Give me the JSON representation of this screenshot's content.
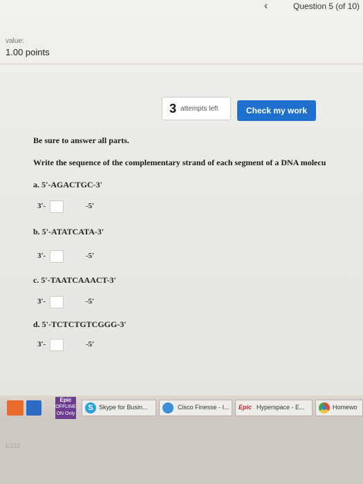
{
  "header": {
    "back_icon": "‹",
    "question": "Question 5 (of 10)"
  },
  "score": {
    "value_label": "value:",
    "points": "1.00 points"
  },
  "attempts": {
    "count": "3",
    "text": "attempts left"
  },
  "check_button": "Check my work",
  "instructions": {
    "line1": "Be sure to answer all parts.",
    "line2": "Write the sequence of the complementary strand of each segment of a DNA molecu"
  },
  "parts": [
    {
      "label": "a. 5'-AGACTGC-3'",
      "prefix": "3'-",
      "suffix": "-5'",
      "answer": ""
    },
    {
      "label": "b. 5'-ATATCATA-3'",
      "prefix": "3'-",
      "suffix": "-5'",
      "answer": ""
    },
    {
      "label": "c. 5'-TAATCAAACT-3'",
      "prefix": "3'-",
      "suffix": "-5'",
      "answer": ""
    },
    {
      "label": "d. 5'-TCTCTGTCGGG-3'",
      "prefix": "3'-",
      "suffix": "-5'",
      "answer": ""
    }
  ],
  "taskbar": {
    "epic_tile": "Epic",
    "epic_sub": "OFFLINE ON Only",
    "skype": "Skype for Busin...",
    "cisco": "Cisco Finesse - I...",
    "epic_logo": "Epic",
    "hyperspace": "Hyperspace - E...",
    "homework": "Homewo"
  },
  "bezel_label": "E232"
}
